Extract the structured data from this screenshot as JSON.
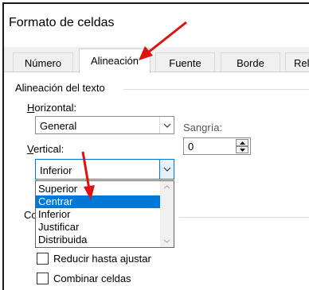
{
  "window": {
    "title": "Formato de celdas"
  },
  "tabs": [
    {
      "label": "Número",
      "active": false
    },
    {
      "label": "Alineación",
      "active": true
    },
    {
      "label": "Fuente",
      "active": false
    },
    {
      "label": "Borde",
      "active": false
    },
    {
      "label": "Rel",
      "active": false
    }
  ],
  "alignment": {
    "group_label": "Alineación del texto",
    "horizontal": {
      "label": "Horizontal:",
      "value": "General"
    },
    "indent": {
      "label": "Sangría:",
      "value": "0"
    },
    "vertical": {
      "label": "Vertical:",
      "value": "Inferior",
      "options": [
        "Superior",
        "Centrar",
        "Inferior",
        "Justificar",
        "Distribuida"
      ],
      "highlighted": "Centrar"
    }
  },
  "control": {
    "group_label_partial": "Co",
    "shrink_label": "Reducir hasta ajustar",
    "merge_label": "Combinar celdas"
  },
  "annotations": {
    "arrow_color": "#e01010"
  },
  "colors": {
    "selection": "#0078d7"
  }
}
